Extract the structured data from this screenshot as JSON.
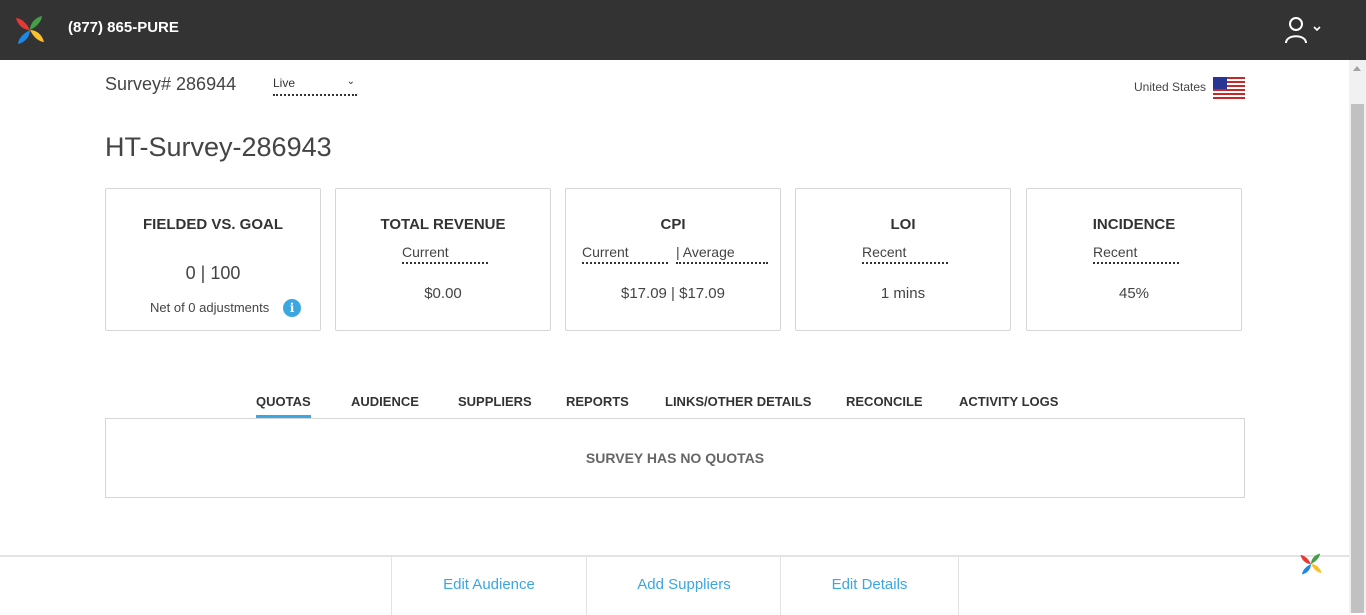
{
  "header": {
    "phone": "(877) 865-PURE",
    "logo_icon": "pinwheel-logo",
    "user_icon": "user-icon"
  },
  "survey": {
    "number_label": "Survey# 286944",
    "status": "Live",
    "country": "United States",
    "title": "HT-Survey-286943"
  },
  "cards": {
    "fielded": {
      "title": "FIELDED VS. GOAL",
      "value": "0 | 100",
      "note": "Net of 0 adjustments"
    },
    "revenue": {
      "title": "TOTAL REVENUE",
      "sub": "Current",
      "value": "$0.00"
    },
    "cpi": {
      "title": "CPI",
      "sub1": "Current",
      "sub2": "| Average",
      "value": "$17.09 | $17.09"
    },
    "loi": {
      "title": "LOI",
      "sub": "Recent",
      "value": "1 mins"
    },
    "incidence": {
      "title": "INCIDENCE",
      "sub": "Recent",
      "value": "45%"
    }
  },
  "tabs": [
    "QUOTAS",
    "AUDIENCE",
    "SUPPLIERS",
    "REPORTS",
    "LINKS/OTHER DETAILS",
    "RECONCILE",
    "ACTIVITY LOGS"
  ],
  "active_tab": "QUOTAS",
  "panel": {
    "empty_message": "SURVEY HAS NO QUOTAS"
  },
  "footer": {
    "edit_audience": "Edit Audience",
    "add_suppliers": "Add Suppliers",
    "edit_details": "Edit Details"
  },
  "colors": {
    "topbar": "#333333",
    "accent": "#3ba6e0"
  }
}
